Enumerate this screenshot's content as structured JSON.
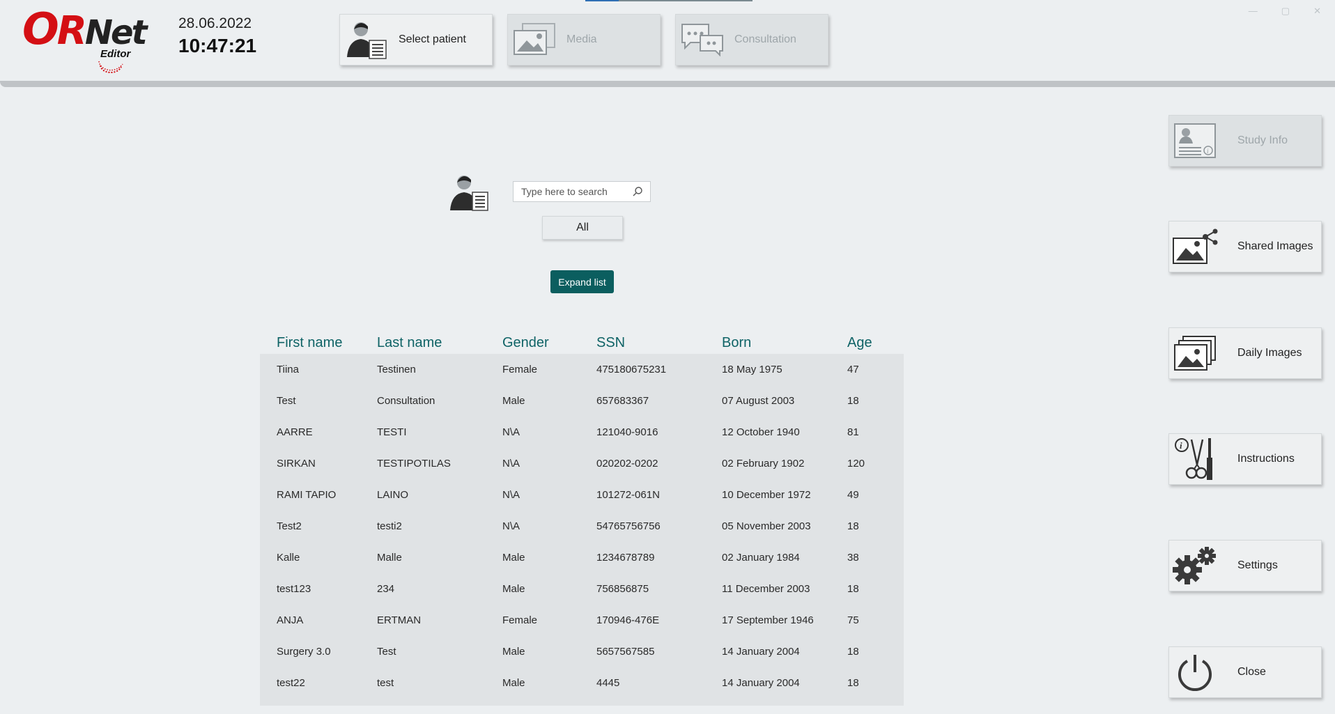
{
  "app": {
    "logo_main": "ORNet",
    "logo_sub": "Editor",
    "date": "28.06.2022",
    "time": "10:47:21",
    "window_controls": [
      "—",
      "▢",
      "✕"
    ]
  },
  "nav": [
    {
      "label": "Select patient",
      "icon": "patient-icon",
      "enabled": true
    },
    {
      "label": "Media",
      "icon": "media-icon",
      "enabled": false
    },
    {
      "label": "Consultation",
      "icon": "consultation-icon",
      "enabled": false
    }
  ],
  "search": {
    "placeholder": "Type here to search",
    "value": "",
    "filter_label": "All",
    "expand_label": "Expand list"
  },
  "table": {
    "headers": [
      "First name",
      "Last name",
      "Gender",
      "SSN",
      "Born",
      "Age"
    ],
    "rows": [
      [
        "Tiina",
        "Testinen",
        "Female",
        "475180675231",
        "18 May 1975",
        "47"
      ],
      [
        "Test",
        "Consultation",
        "Male",
        "657683367",
        "07 August 2003",
        "18"
      ],
      [
        "AARRE",
        "TESTI",
        "N\\A",
        "121040-9016",
        "12 October 1940",
        "81"
      ],
      [
        "SIRKAN",
        "TESTIPOTILAS",
        "N\\A",
        "020202-0202",
        "02 February 1902",
        "120"
      ],
      [
        "RAMI TAPIO",
        "LAINO",
        "N\\A",
        "101272-061N",
        "10 December 1972",
        "49"
      ],
      [
        "Test2",
        "testi2",
        "N\\A",
        "54765756756",
        "05 November 2003",
        "18"
      ],
      [
        "Kalle",
        "Malle",
        "Male",
        "1234678789",
        "02 January 1984",
        "38"
      ],
      [
        "test123",
        "234",
        "Male",
        "756856875",
        "11 December 2003",
        "18"
      ],
      [
        "ANJA",
        "ERTMAN",
        "Female",
        "170946-476E",
        "17 September 1946",
        "75"
      ],
      [
        "Surgery 3.0",
        "Test",
        "Male",
        "5657567585",
        "14 January 2004",
        "18"
      ],
      [
        "test22",
        "test",
        "Male",
        "4445",
        "14 January 2004",
        "18"
      ]
    ]
  },
  "side": [
    {
      "label": "Study Info",
      "icon": "study-info-icon",
      "enabled": false
    },
    {
      "label": "Shared Images",
      "icon": "shared-images-icon",
      "enabled": true
    },
    {
      "label": "Daily Images",
      "icon": "daily-images-icon",
      "enabled": true
    },
    {
      "label": "Instructions",
      "icon": "instructions-icon",
      "enabled": true
    },
    {
      "label": "Settings",
      "icon": "settings-icon",
      "enabled": true
    },
    {
      "label": "Close",
      "icon": "power-icon",
      "enabled": true
    }
  ],
  "colors": {
    "accent": "#0b5e5f",
    "header_text": "#0f6366",
    "brand_red": "#d40f14",
    "background": "#eceff1"
  }
}
